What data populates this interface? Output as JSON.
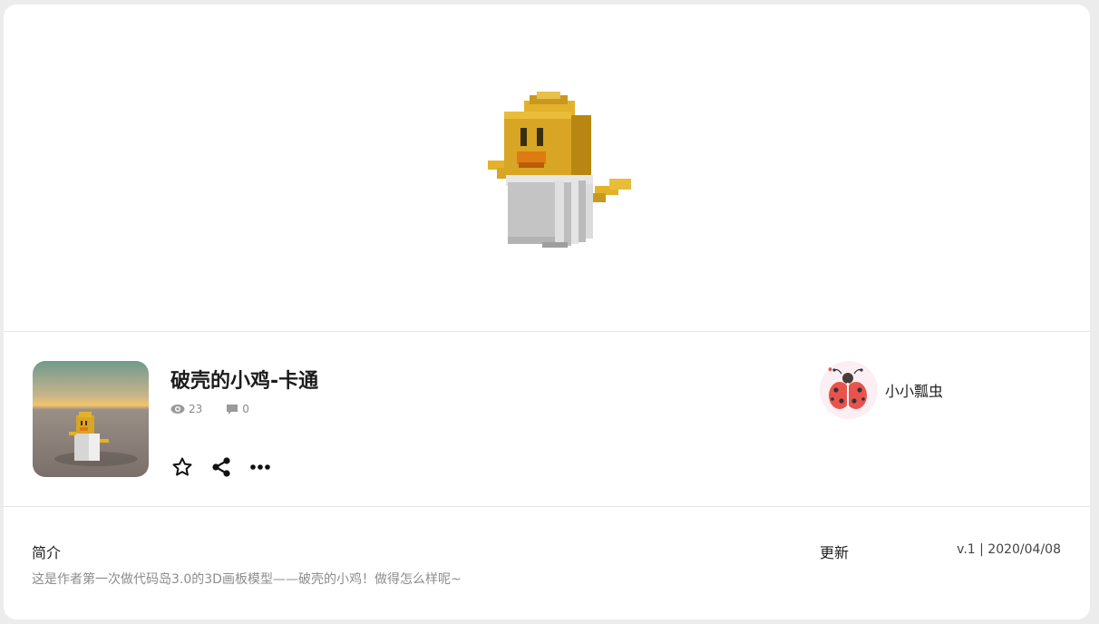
{
  "model": {
    "title": "破壳的小鸡-卡通",
    "views": "23",
    "comments": "0"
  },
  "icons": {
    "views": "eye-icon",
    "comments": "comment-icon",
    "favorite": "star-icon",
    "share": "share-icon",
    "more": "more-icon"
  },
  "author": {
    "name": "小小瓢虫",
    "avatar": "ladybug-avatar"
  },
  "intro": {
    "heading": "简介",
    "text": "这是作者第一次做代码岛3.0的3D画板模型——破壳的小鸡！做得怎么样呢~"
  },
  "update": {
    "heading": "更新",
    "value": "v.1 | 2020/04/08"
  },
  "colors": {
    "chick_yellow": "#e8b52a",
    "shell_grey": "#c9c9c9",
    "text_dark": "#1c1c1c",
    "text_muted": "#8c8c8c",
    "divider": "#e6e6e6"
  }
}
